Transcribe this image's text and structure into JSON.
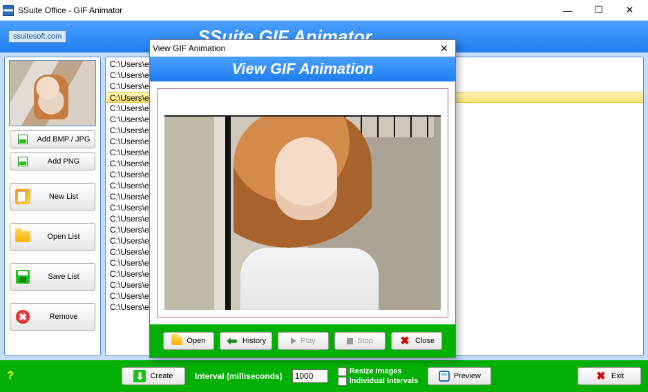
{
  "window": {
    "title": "SSuite Office - GIF Animator",
    "minimize": "—",
    "maximize": "☐",
    "close": "✕"
  },
  "header": {
    "site": "ssuitesoft.com",
    "title": "SSuite GIF Animator"
  },
  "sidebar": {
    "add_bmp": "Add BMP / JPG",
    "add_png": "Add PNG",
    "new_list": "New List",
    "open_list": "Open List",
    "save_list": "Save List",
    "remove": "Remove"
  },
  "filelist": {
    "selected_index": 3,
    "items": [
      "C:\\Users\\e",
      "C:\\Users\\e",
      "C:\\Users\\e",
      "C:\\Users\\e",
      "C:\\Users\\e",
      "C:\\Users\\e",
      "C:\\Users\\e",
      "C:\\Users\\e",
      "C:\\Users\\e",
      "C:\\Users\\e",
      "C:\\Users\\e",
      "C:\\Users\\e",
      "C:\\Users\\e",
      "C:\\Users\\e",
      "C:\\Users\\e",
      "C:\\Users\\e",
      "C:\\Users\\e",
      "C:\\Users\\e",
      "C:\\Users\\e",
      "C:\\Users\\e",
      "C:\\Users\\e",
      "C:\\Users\\e",
      "C:\\Users\\e"
    ]
  },
  "bottom": {
    "help": "?",
    "create": "Create",
    "interval_label": "Interval (milliseconds)",
    "interval_value": "1000",
    "resize": "Resize Images",
    "individual": "Individual Intervals",
    "preview": "Preview",
    "exit": "Exit"
  },
  "modal": {
    "titlebar": "View GIF Animation",
    "close_x": "✕",
    "heading": "View GIF Animation",
    "open": "Open",
    "history": "History",
    "play": "Play",
    "stop": "Stop",
    "close": "Close"
  }
}
